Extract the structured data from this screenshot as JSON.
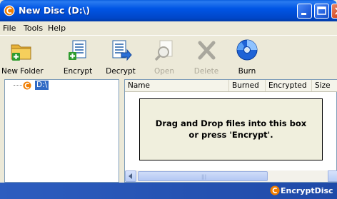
{
  "window": {
    "title": "New Disc (D:\\)"
  },
  "menu": {
    "items": [
      "File",
      "Tools",
      "Help"
    ]
  },
  "toolbar": {
    "items": [
      {
        "label": "New Folder",
        "icon": "folder-add-icon",
        "enabled": true
      },
      {
        "label": "Encrypt",
        "icon": "encrypt-document-icon",
        "enabled": true
      },
      {
        "label": "Decrypt",
        "icon": "decrypt-document-icon",
        "enabled": true
      },
      {
        "label": "Open",
        "icon": "magnifier-icon",
        "enabled": false
      },
      {
        "label": "Delete",
        "icon": "delete-x-icon",
        "enabled": false
      },
      {
        "label": "Burn",
        "icon": "disc-icon",
        "enabled": true
      }
    ]
  },
  "tree": {
    "root_label": "D:\\"
  },
  "list": {
    "columns": [
      "Name",
      "Burned",
      "Encrypted",
      "Size"
    ],
    "drop_hint_line1": "Drag and Drop files into this box",
    "drop_hint_line2": "or press 'Encrypt'."
  },
  "scrollbar": {
    "grip": "|||"
  },
  "brand": {
    "text": "EncryptDisc"
  },
  "colors": {
    "titlebar": "#0055e5",
    "brand_orange": "#f07d00",
    "selection": "#316ac5",
    "dropbox_bg": "#f0efdd"
  }
}
